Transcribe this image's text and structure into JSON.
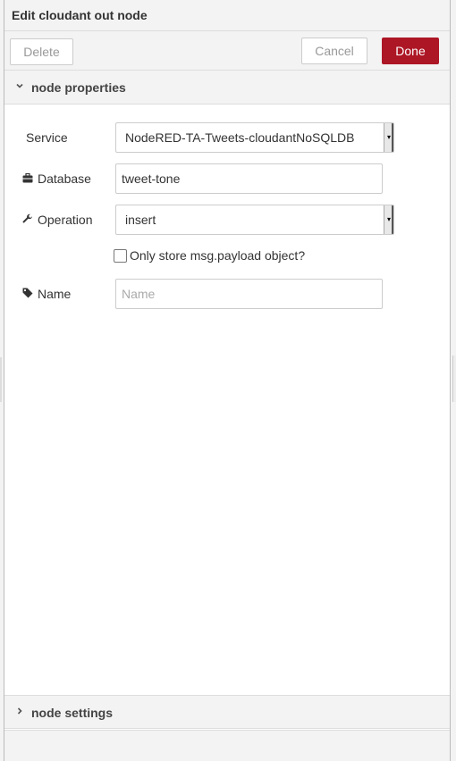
{
  "tray": {
    "title": "Edit cloudant out node"
  },
  "toolbar": {
    "delete_label": "Delete",
    "cancel_label": "Cancel",
    "done_label": "Done"
  },
  "sections": {
    "properties_label": "node properties",
    "properties_expanded": true,
    "settings_label": "node settings",
    "settings_expanded": false
  },
  "form": {
    "service": {
      "label": "Service",
      "value": "NodeRED-TA-Tweets-cloudantNoSQLDB"
    },
    "database": {
      "label": "Database",
      "icon": "briefcase-icon",
      "value": "tweet-tone"
    },
    "operation": {
      "label": "Operation",
      "icon": "wrench-icon",
      "value": "insert"
    },
    "payload_only": {
      "label": "Only store msg.payload object?",
      "checked": false
    },
    "name": {
      "label": "Name",
      "icon": "tag-icon",
      "value": "",
      "placeholder": "Name"
    }
  },
  "colors": {
    "primary": "#ad1625",
    "panel_bg": "#f3f3f3",
    "border": "#cccccc"
  }
}
